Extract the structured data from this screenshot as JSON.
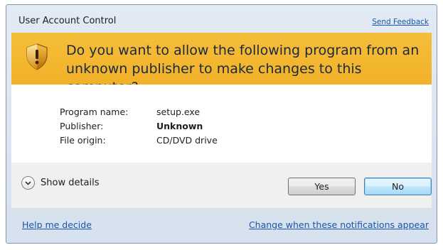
{
  "window": {
    "title": "User Account Control",
    "send_feedback": "Send Feedback"
  },
  "banner": {
    "icon": "warning-shield-icon",
    "question": "Do you want to allow the following program from an unknown publisher to make changes to this computer?",
    "color": "#f2b62f"
  },
  "program": {
    "name_label": "Program name:",
    "name_value": "setup.exe",
    "publisher_label": "Publisher:",
    "publisher_value": "Unknown",
    "origin_label": "File origin:",
    "origin_value": "CD/DVD drive"
  },
  "footer": {
    "show_details": "Show details",
    "yes_label": "Yes",
    "no_label": "No"
  },
  "links": {
    "help": "Help me decide",
    "change": "Change when these notifications appear"
  }
}
